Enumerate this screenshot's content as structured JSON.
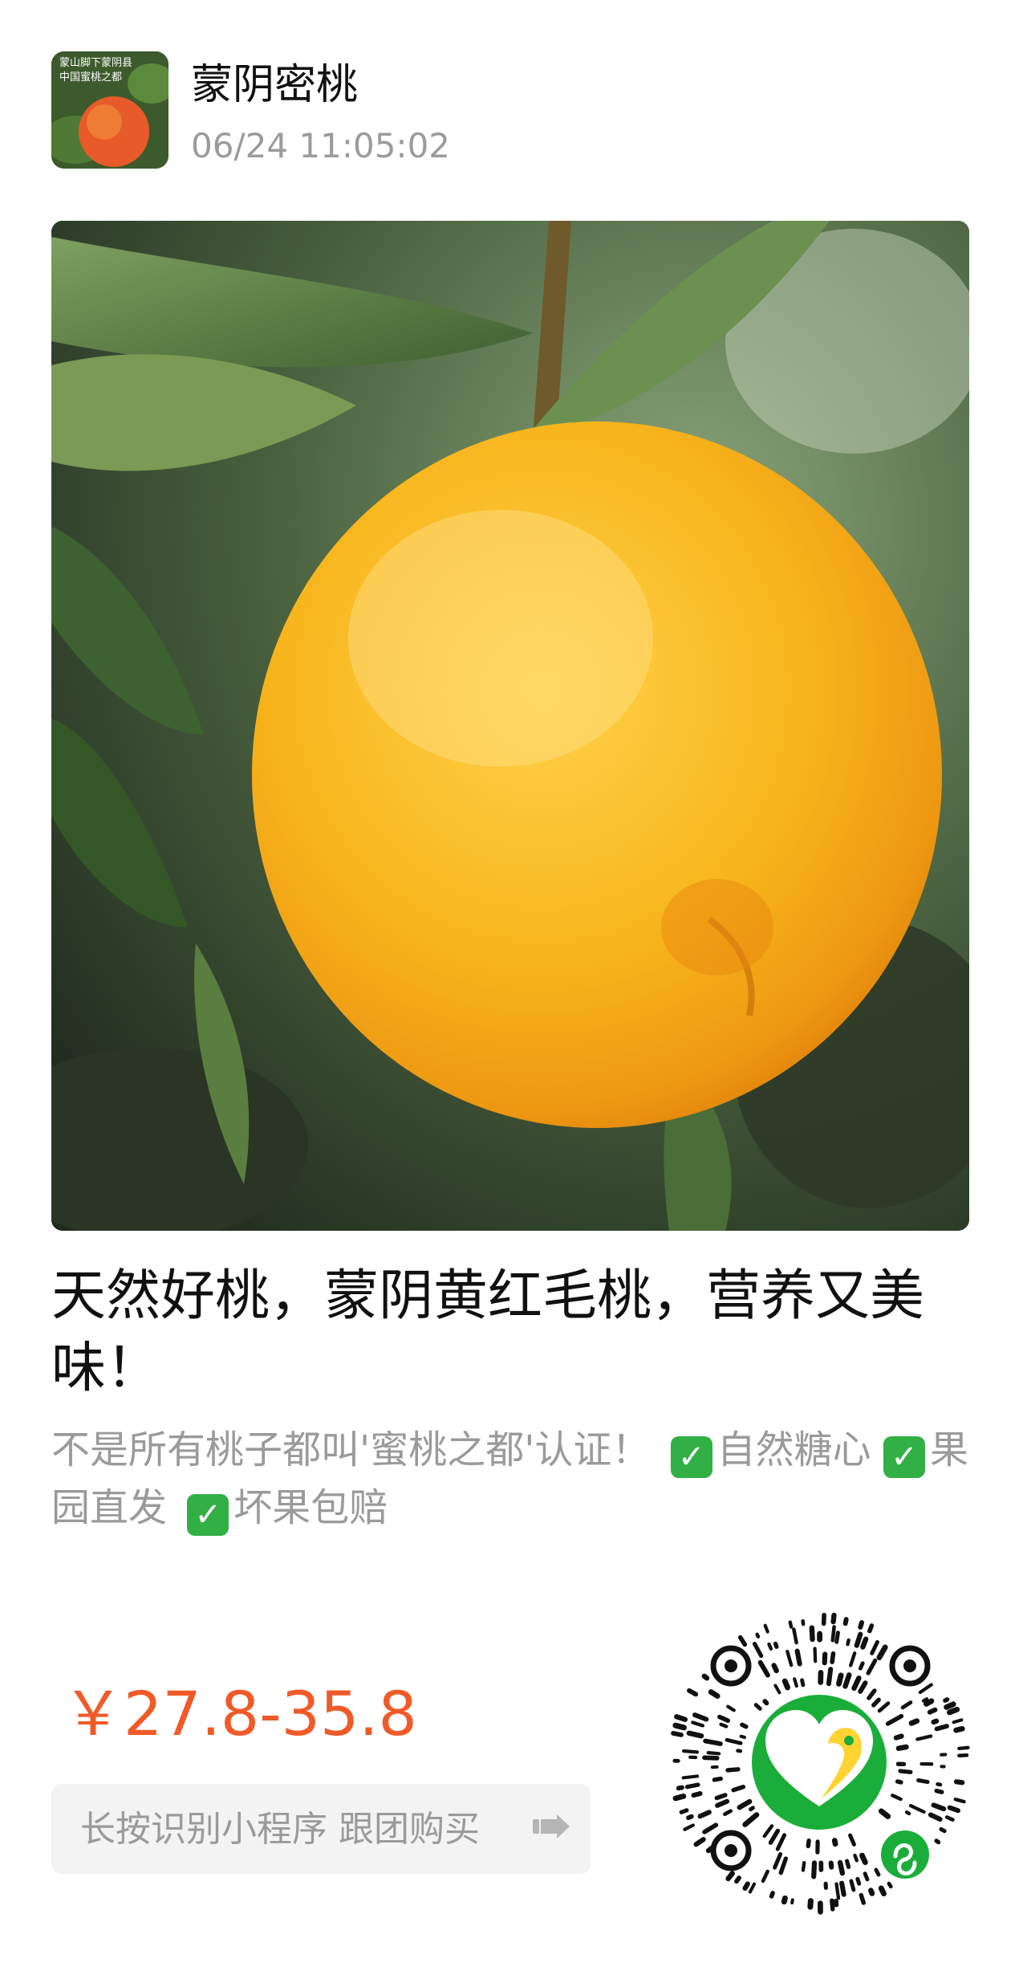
{
  "post": {
    "author_name": "蒙阴密桃",
    "timestamp": "06/24 11:05:02",
    "avatar_caption_line1": "蒙山脚下蒙阴县",
    "avatar_caption_line2": "中国蜜桃之都"
  },
  "product": {
    "title": "天然好桃，蒙阴黄红毛桃，营养又美味！",
    "desc_intro": "不是所有桃子都叫'蜜桃之都'认证！",
    "feature_1": "自然糖心",
    "feature_2": "果园直发",
    "feature_3": "坏果包赔",
    "check_glyph": "✓",
    "price": "￥27.8-35.8"
  },
  "cta": {
    "label": "长按识别小程序 跟团购买",
    "icon": "hand-pointer-icon"
  },
  "qr": {
    "icon": "mini-program-qr-icon",
    "center_logo": "heart-logo-icon",
    "badge": "mini-program-badge-icon"
  },
  "colors": {
    "price": "#f05a28",
    "check_green": "#32b046",
    "muted_text": "#9a9a9a",
    "qr_center_green": "#1aad3a",
    "logo_yellow": "#ffd330"
  }
}
